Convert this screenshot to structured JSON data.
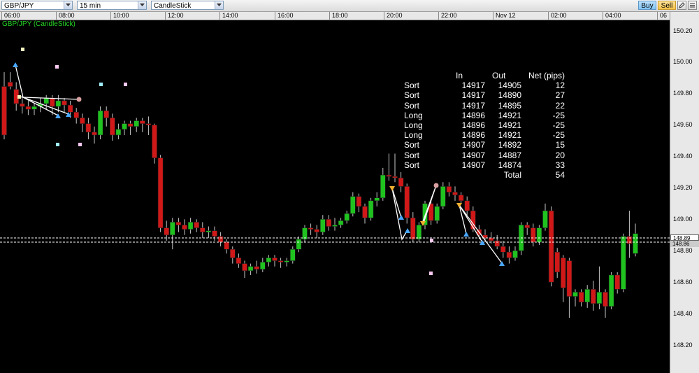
{
  "toolbar": {
    "symbol": "GBP/JPY",
    "interval": "15 min",
    "chart_type": "CandleStick",
    "buy_label": "Buy",
    "sell_label": "Sell",
    "tool_icon_1": "pen-icon",
    "tool_icon_2": "list-icon"
  },
  "chart": {
    "title": "GBP/JPY (CandleStick)",
    "time_labels": [
      "06:00",
      "08:00",
      "10:00",
      "12:00",
      "14:00",
      "16:00",
      "18:00",
      "20:00",
      "22:00",
      "Nov 12",
      "02:00",
      "04:00",
      "06"
    ],
    "price_labels": [
      "150.20",
      "150.00",
      "149.80",
      "149.60",
      "149.40",
      "149.20",
      "149.00",
      "148.80",
      "148.60",
      "148.40",
      "148.20"
    ],
    "current_price_1": "148.89",
    "current_price_2": "148.86",
    "colors": {
      "up": "#1fc21f",
      "down": "#d01818",
      "wick": "#c8c8c8",
      "background": "#000000"
    }
  },
  "chart_data": {
    "type": "candlestick",
    "ylim": [
      148.1,
      150.3
    ],
    "candles": [
      [
        149.92,
        149.58,
        150.02,
        149.55
      ],
      [
        149.95,
        149.92,
        150.02,
        149.9
      ],
      [
        149.9,
        149.8,
        149.95,
        149.75
      ],
      [
        149.8,
        149.78,
        149.85,
        149.73
      ],
      [
        149.78,
        149.76,
        149.82,
        149.72
      ],
      [
        149.76,
        149.78,
        149.8,
        149.72
      ],
      [
        149.78,
        149.8,
        149.84,
        149.74
      ],
      [
        149.8,
        149.84,
        149.86,
        149.76
      ],
      [
        149.84,
        149.78,
        149.86,
        149.72
      ],
      [
        149.78,
        149.82,
        149.86,
        149.74
      ],
      [
        149.82,
        149.79,
        149.84,
        149.74
      ],
      [
        149.79,
        149.74,
        149.82,
        149.7
      ],
      [
        149.74,
        149.7,
        149.77,
        149.66
      ],
      [
        149.7,
        149.66,
        149.73,
        149.6
      ],
      [
        149.66,
        149.6,
        149.7,
        149.55
      ],
      [
        149.6,
        149.58,
        149.64,
        149.52
      ],
      [
        149.58,
        149.75,
        149.78,
        149.55
      ],
      [
        149.75,
        149.7,
        149.78,
        149.64
      ],
      [
        149.7,
        149.58,
        149.73,
        149.54
      ],
      [
        149.58,
        149.62,
        149.66,
        149.55
      ],
      [
        149.62,
        149.66,
        149.68,
        149.58
      ],
      [
        149.66,
        149.64,
        149.68,
        149.58
      ],
      [
        149.64,
        149.68,
        149.7,
        149.6
      ],
      [
        149.68,
        149.66,
        149.7,
        149.6
      ],
      [
        149.66,
        149.65,
        149.71,
        149.58
      ],
      [
        149.65,
        149.42,
        149.66,
        149.38
      ],
      [
        149.42,
        148.93,
        149.44,
        148.9
      ],
      [
        148.93,
        148.88,
        148.98,
        148.84
      ],
      [
        148.88,
        148.97,
        149.0,
        148.78
      ],
      [
        148.97,
        148.95,
        149.0,
        148.9
      ],
      [
        148.95,
        148.92,
        148.99,
        148.88
      ],
      [
        148.92,
        148.97,
        149.0,
        148.89
      ],
      [
        148.97,
        148.93,
        148.99,
        148.9
      ],
      [
        148.93,
        148.9,
        148.97,
        148.86
      ],
      [
        148.9,
        148.91,
        148.94,
        148.86
      ],
      [
        148.91,
        148.87,
        148.94,
        148.84
      ],
      [
        148.87,
        148.83,
        148.9,
        148.8
      ],
      [
        148.83,
        148.78,
        148.85,
        148.75
      ],
      [
        148.78,
        148.72,
        148.8,
        148.68
      ],
      [
        148.72,
        148.68,
        148.75,
        148.65
      ],
      [
        148.68,
        148.63,
        148.7,
        148.58
      ],
      [
        148.63,
        148.66,
        148.68,
        148.6
      ],
      [
        148.66,
        148.64,
        148.7,
        148.61
      ],
      [
        148.64,
        148.69,
        148.72,
        148.62
      ],
      [
        148.69,
        148.72,
        148.74,
        148.66
      ],
      [
        148.72,
        148.7,
        148.74,
        148.66
      ],
      [
        148.7,
        148.69,
        148.72,
        148.65
      ],
      [
        148.69,
        148.7,
        148.72,
        148.66
      ],
      [
        148.7,
        148.78,
        148.8,
        148.68
      ],
      [
        148.78,
        148.85,
        148.87,
        148.76
      ],
      [
        148.85,
        148.93,
        148.95,
        148.83
      ],
      [
        148.93,
        148.92,
        148.96,
        148.88
      ],
      [
        148.92,
        148.9,
        148.95,
        148.86
      ],
      [
        148.9,
        148.99,
        149.02,
        148.88
      ],
      [
        148.99,
        148.94,
        149.02,
        148.91
      ],
      [
        148.94,
        148.95,
        149.0,
        148.91
      ],
      [
        148.95,
        148.98,
        149.0,
        148.93
      ],
      [
        148.98,
        149.03,
        149.05,
        148.96
      ],
      [
        149.03,
        149.15,
        149.18,
        149.01
      ],
      [
        149.15,
        149.08,
        149.17,
        149.04
      ],
      [
        149.08,
        149.0,
        149.1,
        148.96
      ],
      [
        149.0,
        149.12,
        149.14,
        148.98
      ],
      [
        149.12,
        149.14,
        149.18,
        149.08
      ],
      [
        149.14,
        149.3,
        149.35,
        149.12
      ],
      [
        149.3,
        149.29,
        149.45,
        149.26
      ],
      [
        149.29,
        149.28,
        149.45,
        149.25
      ],
      [
        149.28,
        149.22,
        149.32,
        149.18
      ],
      [
        149.22,
        149.0,
        149.24,
        148.96
      ],
      [
        149.0,
        148.85,
        149.04,
        148.83
      ],
      [
        148.85,
        148.95,
        148.97,
        148.83
      ],
      [
        148.95,
        149.1,
        149.12,
        148.92
      ],
      [
        149.1,
        148.98,
        149.12,
        148.95
      ],
      [
        148.98,
        149.08,
        149.1,
        148.96
      ],
      [
        149.08,
        149.22,
        149.25,
        149.06
      ],
      [
        149.22,
        149.18,
        149.25,
        149.15
      ],
      [
        149.18,
        149.16,
        149.22,
        149.12
      ],
      [
        149.16,
        149.12,
        149.18,
        149.1
      ],
      [
        149.12,
        149.05,
        149.15,
        149.02
      ],
      [
        149.05,
        148.92,
        149.08,
        148.9
      ],
      [
        148.92,
        148.88,
        148.95,
        148.85
      ],
      [
        148.88,
        148.86,
        148.92,
        148.83
      ],
      [
        148.86,
        148.84,
        148.9,
        148.82
      ],
      [
        148.84,
        148.8,
        148.88,
        148.78
      ],
      [
        148.8,
        148.76,
        148.84,
        148.72
      ],
      [
        148.76,
        148.72,
        148.8,
        148.68
      ],
      [
        148.72,
        148.77,
        148.8,
        148.7
      ],
      [
        148.77,
        148.95,
        148.97,
        148.74
      ],
      [
        148.95,
        148.93,
        148.97,
        148.88
      ],
      [
        148.93,
        148.83,
        148.96,
        148.8
      ],
      [
        148.83,
        148.93,
        148.95,
        148.81
      ],
      [
        148.93,
        149.05,
        149.1,
        148.91
      ],
      [
        149.05,
        148.55,
        149.08,
        148.52
      ],
      [
        148.76,
        148.62,
        148.79,
        148.58
      ],
      [
        148.72,
        148.51,
        148.74,
        148.41
      ],
      [
        148.7,
        148.45,
        148.72,
        148.3
      ],
      [
        148.45,
        148.48,
        148.5,
        148.38
      ],
      [
        148.48,
        148.41,
        148.5,
        148.38
      ],
      [
        148.41,
        148.5,
        148.53,
        148.37
      ],
      [
        148.5,
        148.4,
        148.56,
        148.35
      ],
      [
        148.4,
        148.48,
        148.66,
        148.36
      ],
      [
        148.48,
        148.38,
        148.5,
        148.3
      ],
      [
        148.38,
        148.6,
        148.62,
        148.36
      ],
      [
        148.6,
        148.5,
        148.62,
        148.47
      ],
      [
        148.5,
        148.87,
        148.89,
        148.48
      ],
      [
        148.87,
        148.82,
        149.05,
        148.72
      ],
      [
        148.75,
        148.89,
        148.96,
        148.73
      ]
    ]
  },
  "pnl_table": {
    "headers": [
      "",
      "In",
      "Out",
      "Net (pips)"
    ],
    "rows": [
      [
        "Sort",
        "14917",
        "14905",
        "12"
      ],
      [
        "Sort",
        "14917",
        "14890",
        "27"
      ],
      [
        "Sort",
        "14917",
        "14895",
        "22"
      ],
      [
        "Long",
        "14896",
        "14921",
        "-25"
      ],
      [
        "Long",
        "14896",
        "14921",
        "-25"
      ],
      [
        "Long",
        "14896",
        "14921",
        "-25"
      ],
      [
        "Sort",
        "14907",
        "14892",
        "15"
      ],
      [
        "Sort",
        "14907",
        "14887",
        "20"
      ],
      [
        "Sort",
        "14907",
        "14874",
        "33"
      ]
    ],
    "total_label": "Total",
    "total_value": "54"
  }
}
